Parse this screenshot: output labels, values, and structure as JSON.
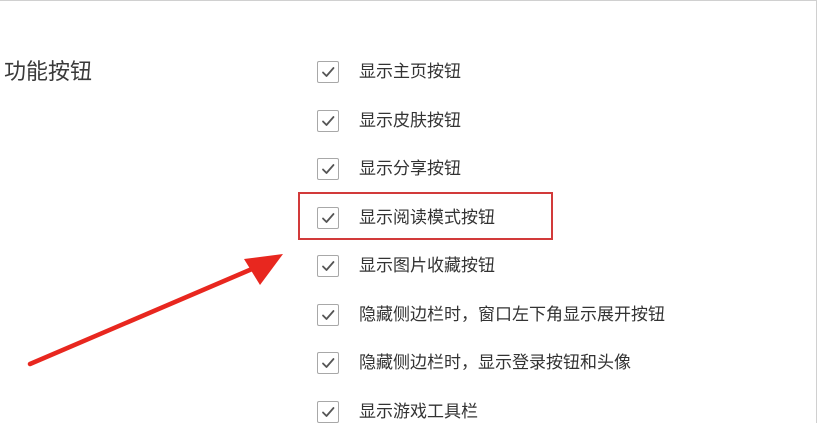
{
  "section": {
    "title": "功能按钮"
  },
  "options": [
    {
      "label": "显示主页按钮",
      "checked": true
    },
    {
      "label": "显示皮肤按钮",
      "checked": true
    },
    {
      "label": "显示分享按钮",
      "checked": true
    },
    {
      "label": "显示阅读模式按钮",
      "checked": true,
      "highlighted": true
    },
    {
      "label": "显示图片收藏按钮",
      "checked": true
    },
    {
      "label": "隐藏侧边栏时，窗口左下角显示展开按钮",
      "checked": true
    },
    {
      "label": "隐藏侧边栏时，显示登录按钮和头像",
      "checked": true
    },
    {
      "label": "显示游戏工具栏",
      "checked": true
    }
  ],
  "annotation": {
    "color": "#e8271f",
    "box_color": "#d23a3a",
    "icon": "red-arrow-icon"
  },
  "colors": {
    "checkmark": "#555555",
    "checkbox_border": "#a8a8a8",
    "text": "#333333"
  }
}
